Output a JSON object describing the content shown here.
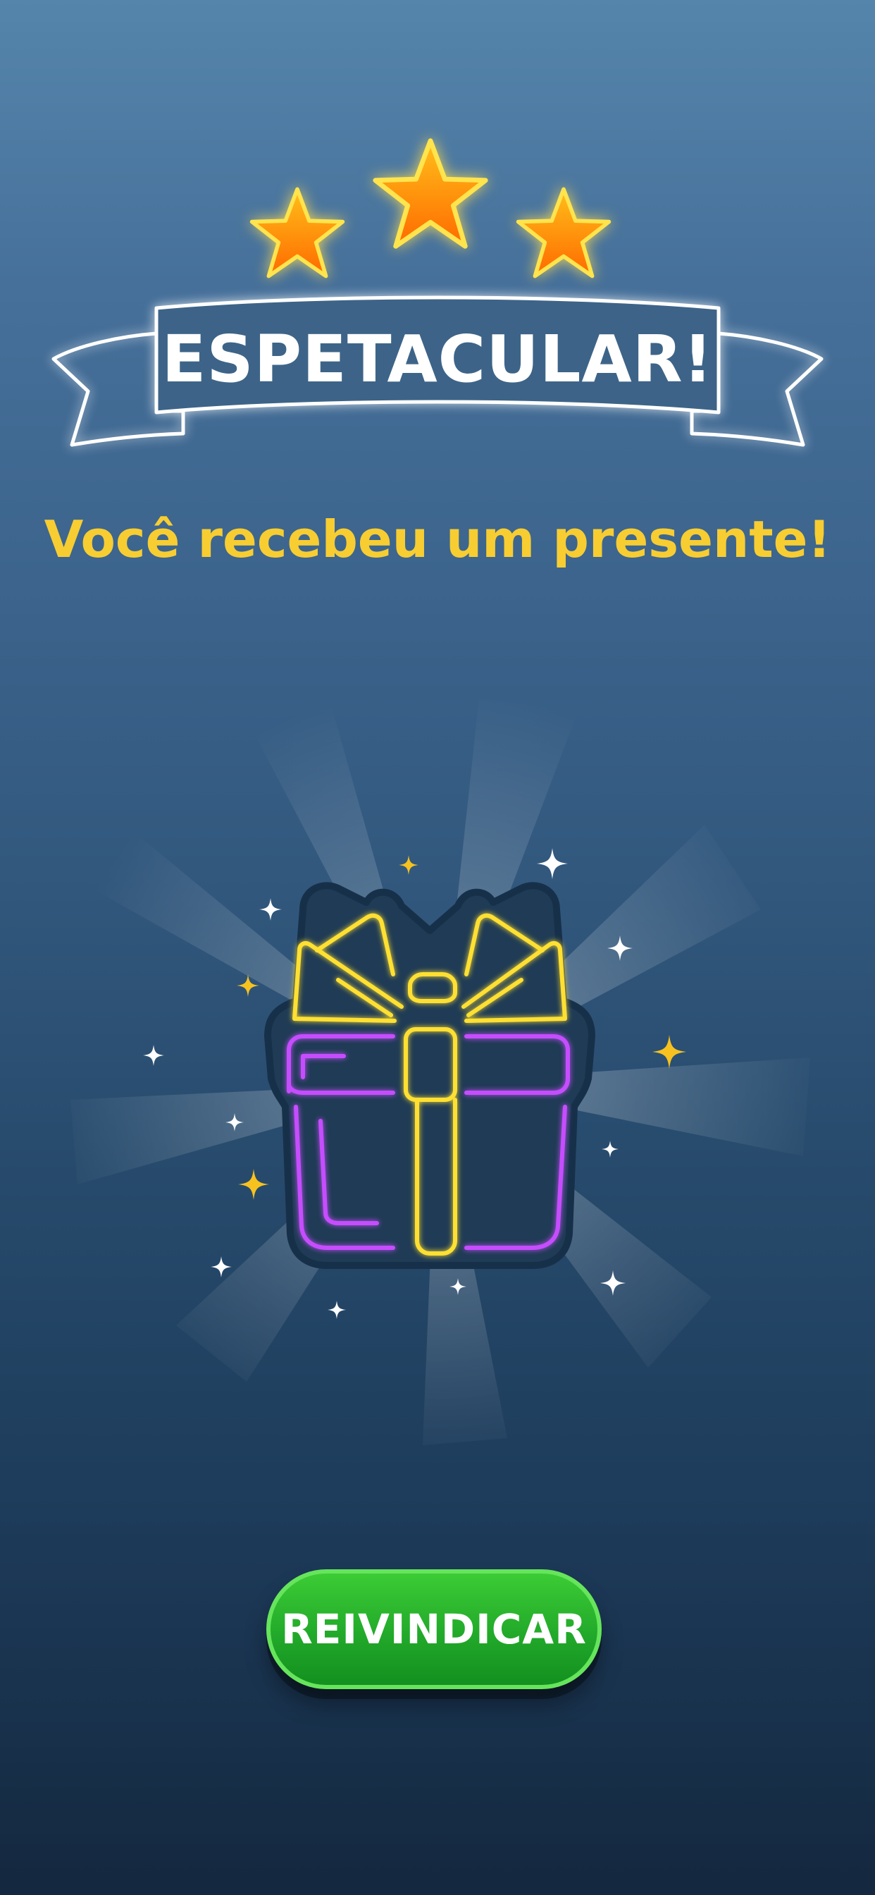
{
  "banner": {
    "title": "ESPETACULAR!"
  },
  "rating": {
    "stars_earned": 3,
    "stars_total": 3
  },
  "message": {
    "subtitle": "Você recebeu um presente!"
  },
  "gift": {
    "icon": "gift-box-icon"
  },
  "actions": {
    "claim_label": "REIVINDICAR"
  },
  "colors": {
    "background_top": "#5585ab",
    "background_bottom": "#14283f",
    "subtitle": "#f7cd32",
    "star_fill": "#ff8c00",
    "gift_ribbon": "#ffe033",
    "gift_box": "#c64dff",
    "button": "#22a92a"
  }
}
